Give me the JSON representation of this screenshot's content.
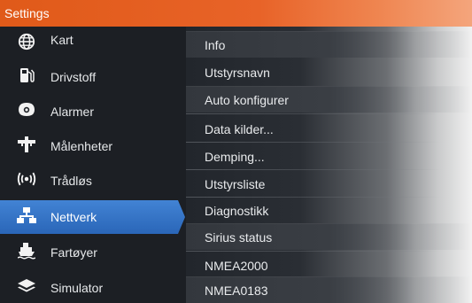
{
  "title": "Settings",
  "accent": "#2f6fc3",
  "titlebar_color": "#e05a19",
  "sidebar": {
    "items": [
      {
        "label": "Kart",
        "icon": "globe-icon",
        "active": false
      },
      {
        "label": "Drivstoff",
        "icon": "fuel-pump-icon",
        "active": false
      },
      {
        "label": "Alarmer",
        "icon": "alarm-bell-icon",
        "active": false
      },
      {
        "label": "Målenheter",
        "icon": "measurement-units-icon",
        "active": false
      },
      {
        "label": "Trådløs",
        "icon": "wireless-icon",
        "active": false
      },
      {
        "label": "Nettverk",
        "icon": "network-icon",
        "active": true
      },
      {
        "label": "Fartøyer",
        "icon": "vessels-icon",
        "active": false
      },
      {
        "label": "Simulator",
        "icon": "layers-icon",
        "active": false
      }
    ]
  },
  "list": {
    "items": [
      {
        "label": "Info",
        "style": "boxed"
      },
      {
        "label": "Utstyrsnavn",
        "style": "plain"
      },
      {
        "label": "Auto konfigurer",
        "style": "boxed"
      },
      {
        "label": "Data kilder...",
        "style": "plain"
      },
      {
        "label": "Demping...",
        "style": "plain"
      },
      {
        "label": "Utstyrsliste",
        "style": "plain"
      },
      {
        "label": "Diagnostikk",
        "style": "plain"
      },
      {
        "label": "Sirius status",
        "style": "boxed"
      },
      {
        "label": "NMEA2000",
        "style": "plain"
      },
      {
        "label": "NMEA0183",
        "style": "boxed"
      }
    ]
  }
}
